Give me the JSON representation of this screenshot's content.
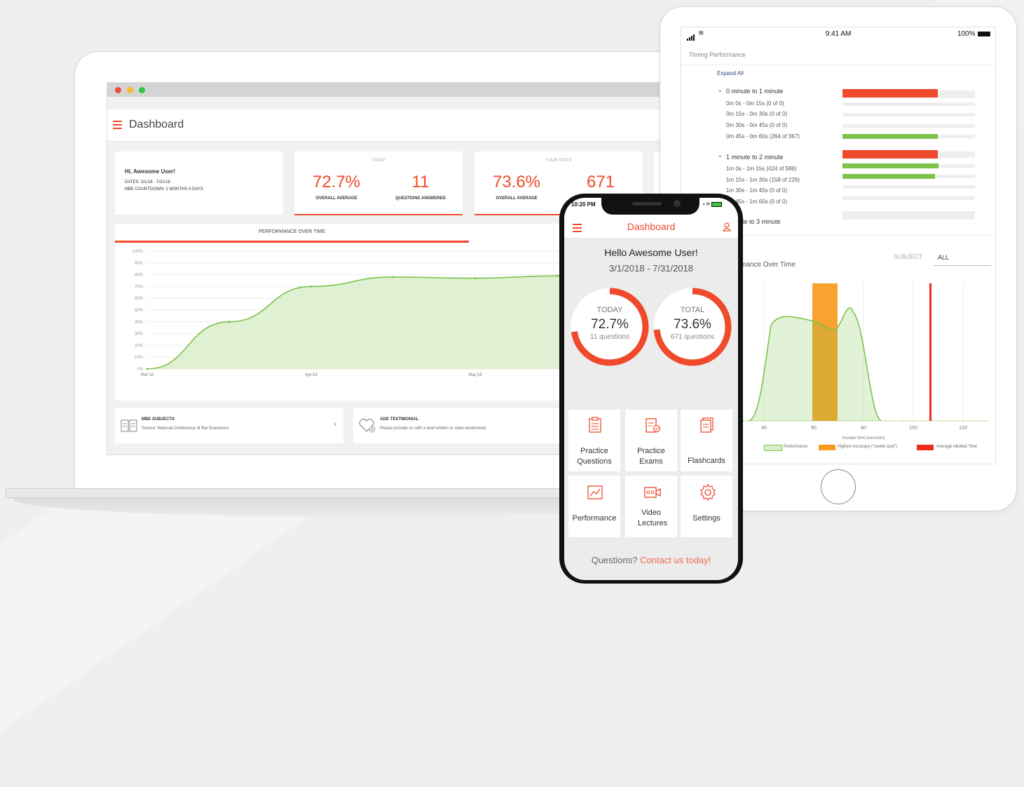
{
  "colors": {
    "accent": "#ef4a2b",
    "green": "#7dc24b",
    "orange": "#f79a1e"
  },
  "laptop": {
    "app_title": "Dashboard",
    "greeting": {
      "title": "Hi, Awesome User!",
      "dates": "DATES: 3/1/18 - 7/31/18",
      "countdown": "MBE COUNTDOWN: 1 MONTHS 4 DAYS"
    },
    "today": {
      "header": "TODAY",
      "avg_value": "72.7%",
      "avg_label": "OVERALL AVERAGE",
      "q_value": "11",
      "q_label": "QUESTIONS ANSWERED"
    },
    "your_stats": {
      "header": "YOUR STATS",
      "avg_value": "73.6%",
      "avg_label": "OVERALL AVERAGE",
      "q_value": "671"
    },
    "perf_title": "PERFORMANCE OVER TIME",
    "mbe": {
      "title": "MBE SUBJECTS",
      "subtitle": "Source: National Conference of Bar Examiners"
    },
    "testimonial": {
      "title": "ADD TESTIMONIAL",
      "subtitle": "Please provide us with a brief written or video testimonial"
    }
  },
  "chart_data": [
    {
      "type": "area",
      "x": [
        "Mar'18",
        "Apr'18",
        "May'18"
      ],
      "y_ticks": [
        "0%",
        "10%",
        "20%",
        "30%",
        "40%",
        "50%",
        "60%",
        "70%",
        "80%",
        "90%",
        "100%"
      ],
      "ylim": [
        0,
        100
      ],
      "series": [
        {
          "values": [
            0,
            40,
            70,
            78,
            77,
            79,
            84
          ]
        }
      ]
    },
    {
      "type": "area",
      "xlabel": "Answer time (seconds)",
      "x_ticks": [
        "40",
        "60",
        "80",
        "100",
        "120"
      ],
      "legend": [
        "Performance",
        "Highest Accuracy (\"sweet spot\")",
        "Average Allotted Time"
      ],
      "legend_position": "bottom"
    }
  ],
  "tablet": {
    "status": {
      "time": "9:41 AM",
      "battery": "100%"
    },
    "header": "Timing Performance",
    "expand_all": "Expand All",
    "group1": {
      "label": "0 minute to 1 minute",
      "rows": [
        "0m 0s - 0m 15s (0 of 0)",
        "0m 15s - 0m 30s (0 of 0)",
        "0m 30s - 0m 45s (0 of 0)",
        "0m 45s - 0m 60s (264 of 367)"
      ]
    },
    "group2": {
      "label": "1 minute to 2 minute",
      "rows": [
        "1m 0s - 1m 15s (424 of 586)",
        "1m 15s - 1m 30s (158 of 226)",
        "1m 30s - 1m 45s (0 of 0)",
        "1m 45s - 1m 60s (0 of 0)"
      ]
    },
    "group3": {
      "label": "ute to 3 minute"
    },
    "chart_title": "mance Over Time",
    "subject_label": "SUBJECT",
    "subject_value": "ALL"
  },
  "phone": {
    "status_time": "10:20 PM",
    "title": "Dashboard",
    "hello": "Hello Awesome User!",
    "dates": "3/1/2018 - 7/31/2018",
    "today": {
      "label": "TODAY",
      "value": "72.7%",
      "sub": "11 questions",
      "fraction": 0.727
    },
    "total": {
      "label": "TOTAL",
      "value": "73.6%",
      "sub": "671 questions",
      "fraction": 0.736
    },
    "tiles": [
      "Practice Questions",
      "Practice Exams",
      "Flashcards",
      "Performance",
      "Video Lectures",
      "Settings"
    ],
    "footer_q": "Questions?",
    "footer_link": "Contact us today!"
  }
}
